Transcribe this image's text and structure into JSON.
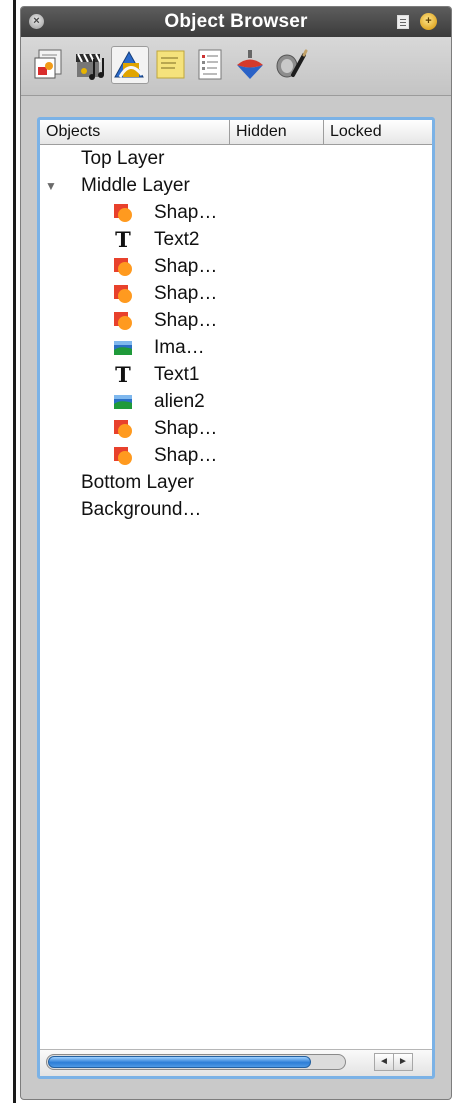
{
  "window": {
    "title": "Object Browser"
  },
  "toolbar": {
    "icons": [
      "layout-icon",
      "media-icon",
      "objects-icon",
      "sticky-note-icon",
      "document-list-icon",
      "spinning-top-icon",
      "paint-tools-icon"
    ],
    "selected_index": 2
  },
  "table": {
    "columns": [
      "Objects",
      "Hidden",
      "Locked"
    ],
    "rows": [
      {
        "label": "Top Layer",
        "level": 0,
        "type": "layer"
      },
      {
        "label": "Middle Layer",
        "level": 0,
        "type": "layer",
        "expanded": true
      },
      {
        "label": "Shap…",
        "level": 1,
        "type": "shape"
      },
      {
        "label": "Text2",
        "level": 1,
        "type": "text"
      },
      {
        "label": "Shap…",
        "level": 1,
        "type": "shape"
      },
      {
        "label": "Shap…",
        "level": 1,
        "type": "shape"
      },
      {
        "label": "Shap…",
        "level": 1,
        "type": "shape"
      },
      {
        "label": "Ima…",
        "level": 1,
        "type": "image"
      },
      {
        "label": "Text1",
        "level": 1,
        "type": "text"
      },
      {
        "label": "alien2",
        "level": 1,
        "type": "image"
      },
      {
        "label": "Shap…",
        "level": 1,
        "type": "shape"
      },
      {
        "label": "Shap…",
        "level": 1,
        "type": "shape"
      },
      {
        "label": "Bottom Layer",
        "level": 0,
        "type": "layer"
      },
      {
        "label": "Background…",
        "level": 0,
        "type": "layer"
      }
    ]
  },
  "scrollbar": {
    "horizontal_position_fraction": 0.0,
    "visible_fraction": 0.89
  },
  "colors": {
    "titlebar": "#4a4a4a",
    "focus_ring": "#7bb2e6",
    "shape_red": "#e8412c",
    "shape_orange": "#ff9a1f",
    "scroll_thumb": "#2d7ed6"
  }
}
